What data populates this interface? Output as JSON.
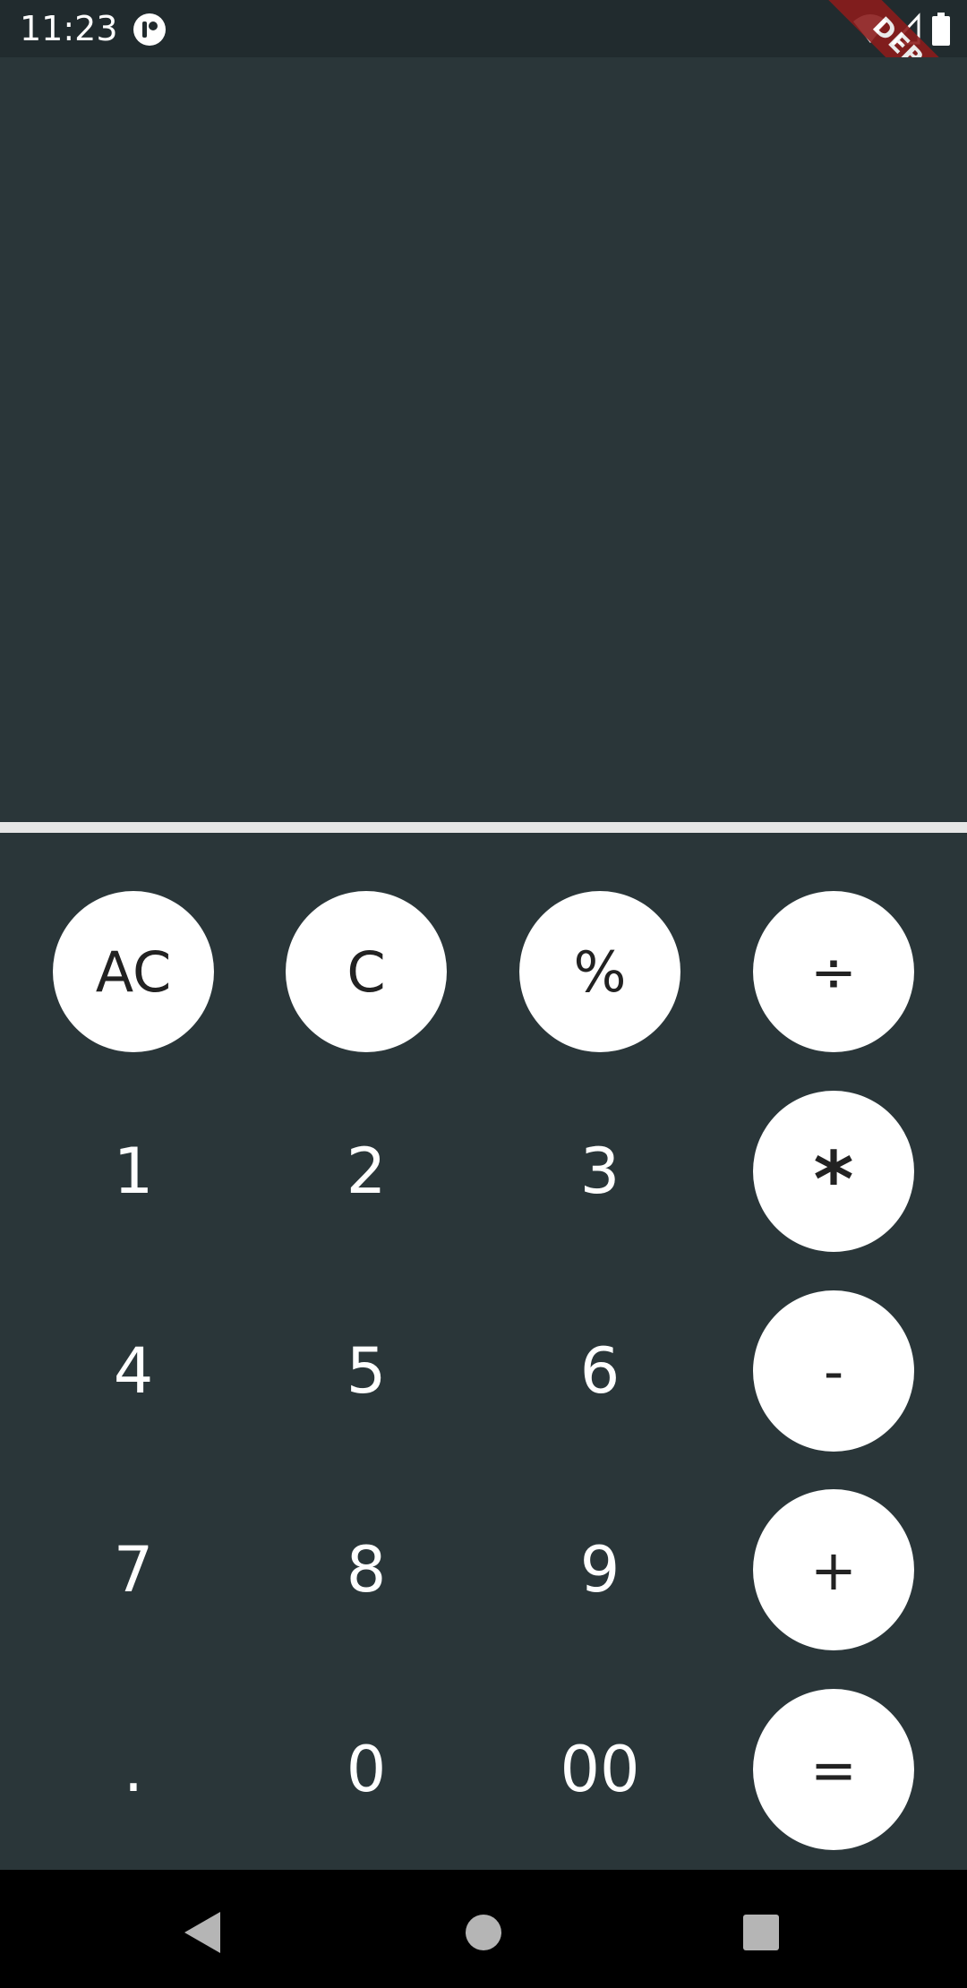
{
  "status_bar": {
    "time": "11:23",
    "icons": [
      "app-notification-icon",
      "wifi-icon",
      "cell-signal-icon",
      "battery-icon"
    ]
  },
  "debug_banner": {
    "label": "DEBUG",
    "color": "#8b1c1c"
  },
  "display": {
    "value": ""
  },
  "keypad": {
    "row1": [
      "AC",
      "C",
      "%",
      "÷"
    ],
    "row2": [
      "1",
      "2",
      "3",
      "*"
    ],
    "row3": [
      "4",
      "5",
      "6",
      "-"
    ],
    "row4": [
      "7",
      "8",
      "9",
      "+"
    ],
    "row5": [
      ".",
      "0",
      "00",
      "="
    ]
  },
  "nav_bar": {
    "icons": [
      "back-icon",
      "home-icon",
      "recents-icon"
    ]
  },
  "colors": {
    "background": "#2a3639",
    "status_bar": "#212b2e",
    "divider": "#e6e6e6",
    "key_circle": "#ffffff",
    "key_circle_text": "#222222",
    "key_plain_text": "#ffffff"
  }
}
